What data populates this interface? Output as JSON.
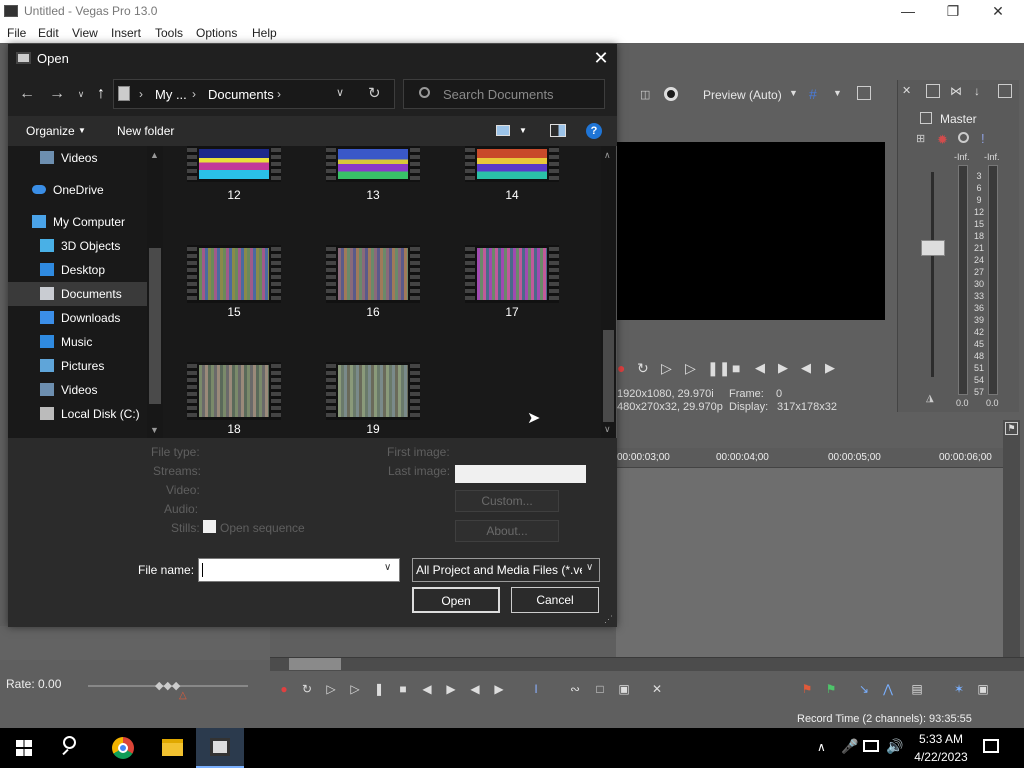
{
  "window": {
    "title": "Untitled - Vegas Pro 13.0",
    "controls": [
      "minimize",
      "maximize",
      "close"
    ]
  },
  "menu": [
    "File",
    "Edit",
    "View",
    "Insert",
    "Tools",
    "Options",
    "Help"
  ],
  "preview": {
    "mode": "Preview (Auto)",
    "info_line1": "1920x1080, 29.970i",
    "info_line2": "480x270x32, 29.970p",
    "frame_label": "Frame:",
    "frame_value": "0",
    "display_label": "Display:",
    "display_value": "317x178x32"
  },
  "master": {
    "title": "Master",
    "peak_left": "-Inf.",
    "peak_right": "-Inf.",
    "scale": [
      "3",
      "6",
      "9",
      "12",
      "15",
      "18",
      "21",
      "24",
      "27",
      "30",
      "33",
      "36",
      "39",
      "42",
      "45",
      "48",
      "51",
      "54",
      "57"
    ],
    "value_left": "0.0",
    "value_right": "0.0"
  },
  "timeline": {
    "timecodes": [
      "00:00:03;00",
      "00:00:04;00",
      "00:00:05;00",
      "00:00:06;00"
    ]
  },
  "rate": "Rate: 0.00",
  "status": {
    "record_time": "Record Time (2 channels): 93:35:55"
  },
  "dialog": {
    "title": "Open",
    "breadcrumb": [
      "My ...",
      "Documents"
    ],
    "search_placeholder": "Search Documents",
    "organize": "Organize",
    "new_folder": "New folder",
    "nav_items": [
      {
        "label": "Videos",
        "icon": "videos-icon"
      },
      {
        "label": "OneDrive",
        "icon": "onedrive-icon"
      },
      {
        "label": "My Computer",
        "icon": "computer-icon"
      },
      {
        "label": "3D Objects",
        "icon": "3d-objects-icon"
      },
      {
        "label": "Desktop",
        "icon": "desktop-icon"
      },
      {
        "label": "Documents",
        "icon": "documents-icon"
      },
      {
        "label": "Downloads",
        "icon": "downloads-icon"
      },
      {
        "label": "Music",
        "icon": "music-icon"
      },
      {
        "label": "Pictures",
        "icon": "pictures-icon"
      },
      {
        "label": "Videos",
        "icon": "videos-icon"
      },
      {
        "label": "Local Disk (C:)",
        "icon": "local-disk-icon"
      }
    ],
    "selected_nav": "Documents",
    "files": [
      "12",
      "13",
      "14",
      "15",
      "16",
      "17",
      "18",
      "19"
    ],
    "meta": {
      "file_type": "File type:",
      "streams": "Streams:",
      "video": "Video:",
      "audio": "Audio:",
      "stills": "Stills:",
      "open_sequence": "Open sequence",
      "first_image": "First image:",
      "last_image": "Last image:"
    },
    "custom_button": "Custom...",
    "about_button": "About...",
    "file_name_label": "File name:",
    "file_name_value": "",
    "file_type_value": "All Project and Media Files (*.veg",
    "open_button": "Open",
    "cancel_button": "Cancel"
  },
  "taskbar": {
    "time": "5:33 AM",
    "date": "4/22/2023"
  }
}
